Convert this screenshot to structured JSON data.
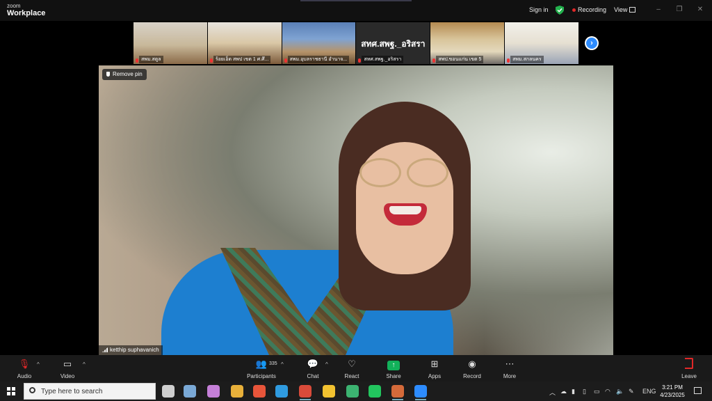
{
  "app": {
    "brand_top": "zoom",
    "brand_bottom": "Workplace"
  },
  "topbar": {
    "signin": "Sign in",
    "recording": "Recording",
    "view": "View",
    "window_controls": [
      "–",
      "❐",
      "✕"
    ]
  },
  "thumbnails": [
    {
      "name": "สพม.สตูล"
    },
    {
      "name": "ร้อยเอ็ด สพป เขต 1 ศ.ศึ..."
    },
    {
      "name": "สพม.อุบลราชธานี อำนาจ..."
    },
    {
      "name": "สทศ.สพฐ._อริสรา",
      "big_label": "สทศ.สพฐ._อริสรา"
    },
    {
      "name": "สพป.ขอนแก่น เขต 5"
    },
    {
      "name": "สพม.สกลนคร"
    }
  ],
  "main_video": {
    "remove_pin": "Remove pin",
    "participant_name": "ketthip suphavanich"
  },
  "controls": {
    "audio": "Audio",
    "video": "Video",
    "participants": "Participants",
    "participants_count": "335",
    "chat": "Chat",
    "react": "React",
    "share": "Share",
    "apps": "Apps",
    "record": "Record",
    "more": "More",
    "leave": "Leave"
  },
  "taskbar": {
    "search_placeholder": "Type here to search",
    "language": "ENG",
    "time": "3:21 PM",
    "date": "4/23/2025",
    "apps": [
      {
        "icon": "task-view-icon",
        "color": "#cfcfcf"
      },
      {
        "icon": "photos-icon",
        "color": "#7aa9d6"
      },
      {
        "icon": "copilot-icon",
        "color": "#c57fd8"
      },
      {
        "icon": "chrome-profile-icon",
        "color": "#e8b03a"
      },
      {
        "icon": "rss-app-icon",
        "color": "#e8553a"
      },
      {
        "icon": "edge-icon",
        "color": "#2f9be0"
      },
      {
        "icon": "chrome-icon",
        "color": "#d94b3a"
      },
      {
        "icon": "file-explorer-icon",
        "color": "#f2c230"
      },
      {
        "icon": "chrome-profile-2-icon",
        "color": "#3cb371"
      },
      {
        "icon": "line-icon",
        "color": "#22c55e"
      },
      {
        "icon": "pinned-app-icon",
        "color": "#d46a3a"
      },
      {
        "icon": "zoom-icon",
        "color": "#2d8cff"
      }
    ]
  },
  "colors": {
    "zoom_blue": "#2d8cff",
    "record_red": "#e02828",
    "share_green": "#12b15a"
  }
}
